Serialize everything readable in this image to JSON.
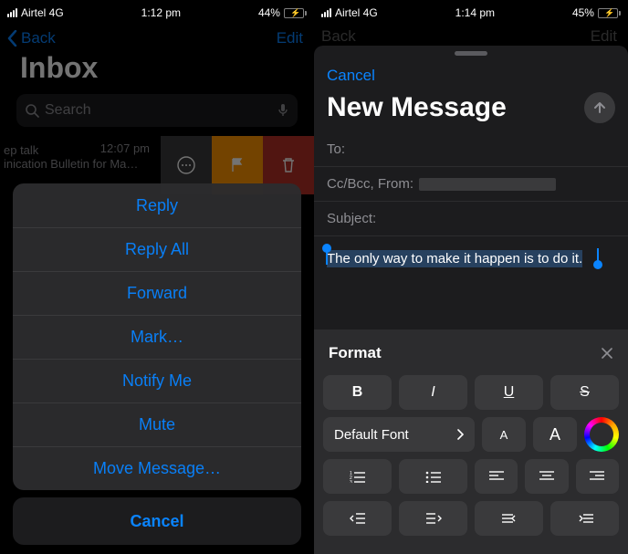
{
  "left": {
    "status": {
      "carrier": "Airtel 4G",
      "time": "1:12 pm",
      "battery_pct": "44%",
      "battery_fill": 44
    },
    "nav": {
      "back": "Back",
      "edit": "Edit"
    },
    "title": "Inbox",
    "search": {
      "placeholder": "Search"
    },
    "mail": {
      "time": "12:07 pm",
      "line1": "ep talk",
      "line2": "inication Bulletin for Ma…"
    },
    "actions": [
      "Reply",
      "Reply All",
      "Forward",
      "Mark…",
      "Notify Me",
      "Mute",
      "Move Message…"
    ],
    "cancel": "Cancel"
  },
  "right": {
    "status": {
      "carrier": "Airtel 4G",
      "time": "1:14 pm",
      "battery_pct": "45%",
      "battery_fill": 45
    },
    "dim_nav": {
      "back": "Back",
      "edit": "Edit"
    },
    "compose": {
      "cancel": "Cancel",
      "title": "New Message",
      "to_label": "To:",
      "ccbcc_label": "Cc/Bcc, From:",
      "subject_label": "Subject:",
      "body_selected": "The only way to make it happen is to do it."
    },
    "format": {
      "title": "Format",
      "bold": "B",
      "italic": "I",
      "underline": "U",
      "strike": "S",
      "font": "Default Font",
      "sizeDown": "A",
      "sizeUp": "A"
    }
  }
}
